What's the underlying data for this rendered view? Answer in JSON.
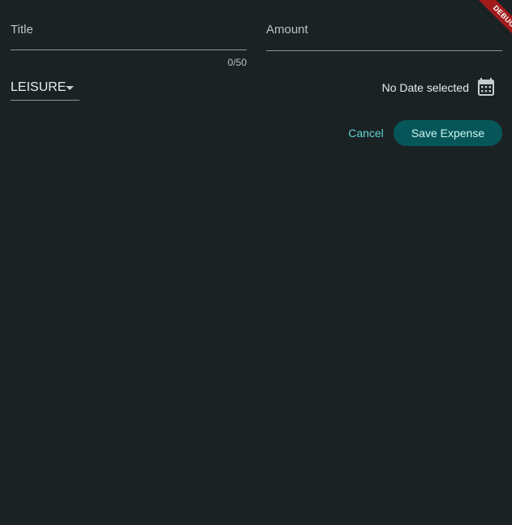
{
  "form": {
    "title": {
      "label": "Title",
      "value": "",
      "counter": "0/50"
    },
    "amount": {
      "label": "Amount",
      "value": ""
    },
    "category": {
      "selected": "LEISURE"
    },
    "date": {
      "text": "No Date selected",
      "icon": "calendar-icon"
    },
    "actions": {
      "cancel_label": "Cancel",
      "save_label": "Save Expense"
    }
  },
  "debug_banner": {
    "label": "DEBUG"
  },
  "colors": {
    "background": "#1b2224",
    "accent": "#5fd3d3",
    "primary_button": "#065659",
    "debug": "#a11b1b"
  }
}
